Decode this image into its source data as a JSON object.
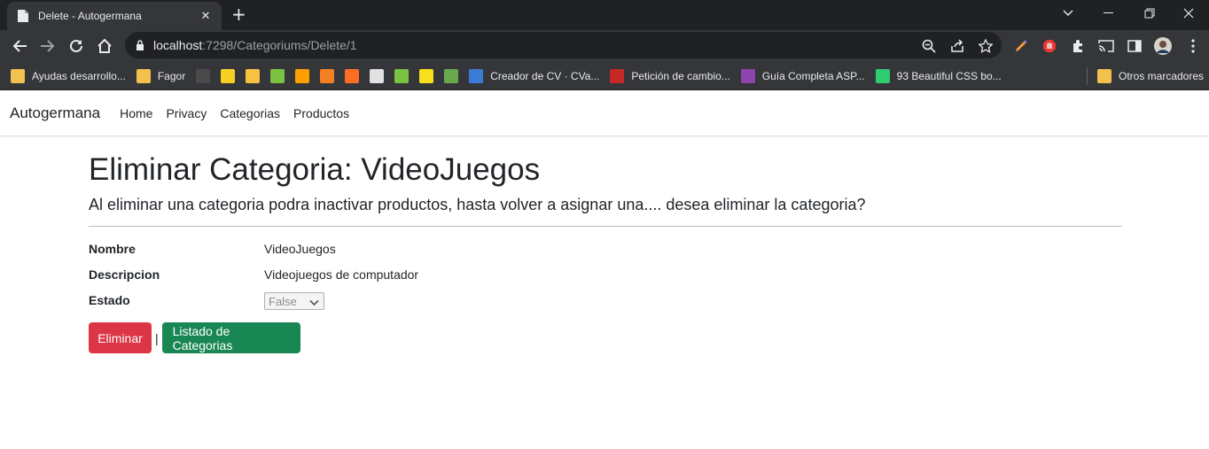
{
  "browser": {
    "tab_title": "Delete - Autogermana",
    "tab_close": "✕",
    "new_tab": "+",
    "url_host": "localhost",
    "url_path": ":7298/Categoriums/Delete/1",
    "bookmarks": [
      {
        "label": "Ayudas desarrollo...",
        "icon": "folder-icon",
        "color": "#f2c14e"
      },
      {
        "label": "Fagor",
        "icon": "folder-icon",
        "color": "#f2c14e"
      },
      {
        "label": "",
        "icon": "github-icon",
        "color": "#4a4a4a"
      },
      {
        "label": "",
        "icon": "miro-icon",
        "color": "#f7d023"
      },
      {
        "label": "",
        "icon": "emoji-icon",
        "color": "#f5c242"
      },
      {
        "label": "",
        "icon": "diamond-icon",
        "color": "#7cc242"
      },
      {
        "label": "",
        "icon": "firebase-icon",
        "color": "#ffa000"
      },
      {
        "label": "",
        "icon": "stackoverflow-icon",
        "color": "#f48024"
      },
      {
        "label": "",
        "icon": "gitlab-icon",
        "color": "#fc6d26"
      },
      {
        "label": "",
        "icon": "search-app-icon",
        "color": "#e0e0e0"
      },
      {
        "label": "",
        "icon": "diamond-icon",
        "color": "#7cc242"
      },
      {
        "label": "",
        "icon": "js-icon",
        "color": "#f7df1e"
      },
      {
        "label": "",
        "icon": "globe-icon",
        "color": "#6aa84f"
      },
      {
        "label": "Creador de CV · CVa...",
        "icon": "cv-icon",
        "color": "#3a7bd5"
      },
      {
        "label": "Petición de cambio...",
        "icon": "rainbow-icon",
        "color": "#c62828"
      },
      {
        "label": "Guía Completa ASP...",
        "icon": "u-icon",
        "color": "#8e44ad"
      },
      {
        "label": "93 Beautiful CSS bo...",
        "icon": "css-icon",
        "color": "#2ecc71"
      }
    ],
    "other_bookmarks": "Otros marcadores"
  },
  "navbar": {
    "brand": "Autogermana",
    "links": [
      "Home",
      "Privacy",
      "Categorias",
      "Productos"
    ]
  },
  "page": {
    "title": "Eliminar Categoria: VideoJuegos",
    "subtitle": "Al eliminar una categoria podra inactivar productos, hasta volver a asignar una.... desea eliminar la categoria?",
    "fields": {
      "nombre_label": "Nombre",
      "nombre_value": "VideoJuegos",
      "descripcion_label": "Descripcion",
      "descripcion_value": "Videojuegos de computador",
      "estado_label": "Estado",
      "estado_value": "False"
    },
    "delete_button": "Eliminar",
    "separator": "|",
    "list_button": "Listado de Categorias"
  },
  "colors": {
    "danger": "#dc3545",
    "success": "#198754",
    "chrome_dark": "#202124",
    "chrome_mid": "#35363a"
  }
}
